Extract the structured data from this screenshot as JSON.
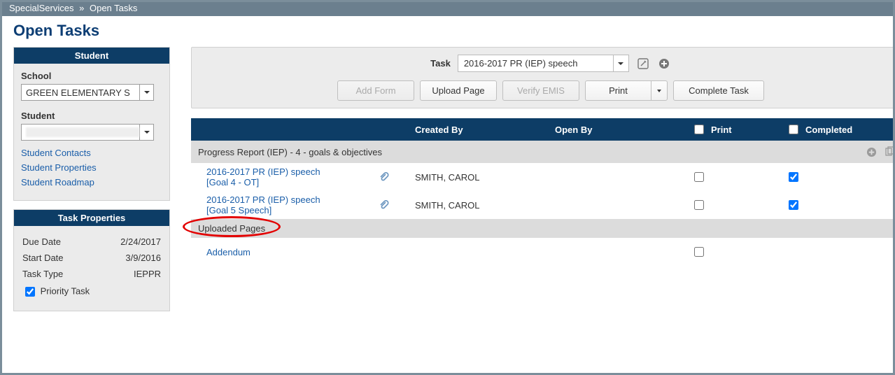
{
  "breadcrumb": {
    "root": "SpecialServices",
    "sep": "»",
    "current": "Open Tasks"
  },
  "page": {
    "title": "Open Tasks"
  },
  "sidebar": {
    "student_panel": {
      "header": "Student",
      "school_label": "School",
      "school_value": "GREEN ELEMENTARY S",
      "student_label": "Student",
      "student_value": "",
      "links": {
        "contacts": "Student Contacts",
        "properties": "Student Properties",
        "roadmap": "Student Roadmap"
      }
    },
    "task_props_panel": {
      "header": "Task Properties",
      "due_date_label": "Due Date",
      "due_date_value": "2/24/2017",
      "start_date_label": "Start Date",
      "start_date_value": "3/9/2016",
      "task_type_label": "Task Type",
      "task_type_value": "IEPPR",
      "priority_label": "Priority Task"
    }
  },
  "toolbar": {
    "task_label": "Task",
    "task_value": "2016-2017 PR (IEP) speech",
    "add_form": "Add Form",
    "upload_page": "Upload Page",
    "verify_emis": "Verify EMIS",
    "print": "Print",
    "complete_task": "Complete Task"
  },
  "table": {
    "headers": {
      "created_by": "Created By",
      "open_by": "Open By",
      "print": "Print",
      "completed": "Completed"
    },
    "group1": {
      "title": "Progress Report (IEP) - 4 - goals & objectives",
      "rows": [
        {
          "name_line1": "2016-2017 PR (IEP) speech",
          "name_line2": "[Goal 4 - OT]",
          "created_by": "SMITH, CAROL",
          "open_by": "",
          "completed_checked": true
        },
        {
          "name_line1": "2016-2017 PR (IEP) speech",
          "name_line2": "[Goal 5 Speech]",
          "created_by": "SMITH, CAROL",
          "open_by": "",
          "completed_checked": true
        }
      ]
    },
    "group2": {
      "title": "Uploaded Pages",
      "row": {
        "name": "Addendum"
      }
    }
  },
  "icons": {
    "edit": "edit-icon",
    "plus": "plus-circle-icon",
    "attachment": "attachment-icon",
    "copy": "copy-icon",
    "trash": "trash-icon",
    "caret": "chevron-down-icon"
  }
}
